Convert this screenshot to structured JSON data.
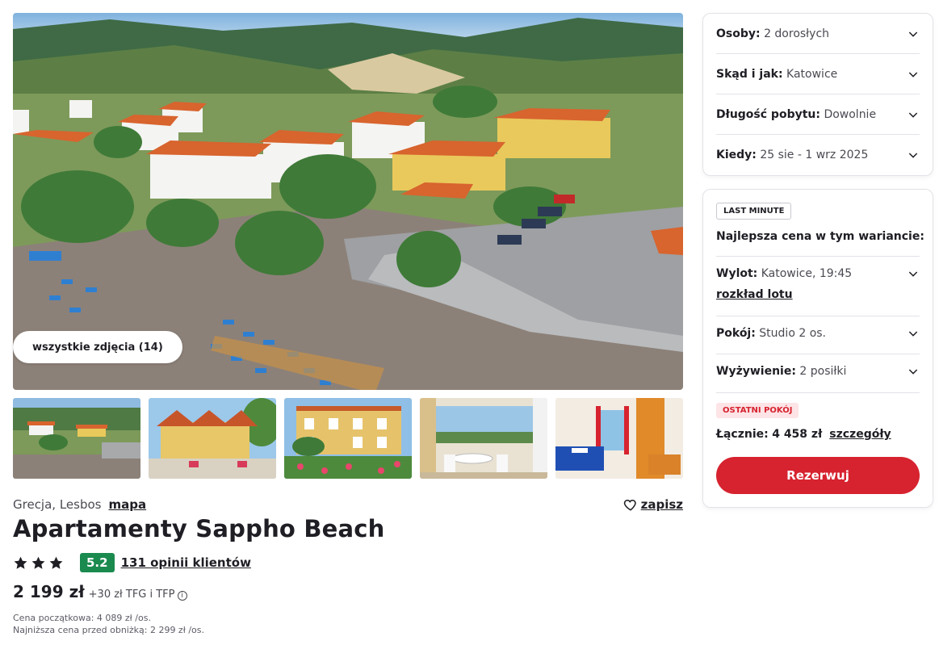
{
  "gallery": {
    "all_photos_label": "wszystkie zdjęcia (14)"
  },
  "hotel": {
    "location": "Grecja, Lesbos",
    "map_label": "mapa",
    "save_label": "zapisz",
    "name": "Apartamenty Sappho Beach",
    "stars": 3,
    "score": "5.2",
    "reviews_label": "131 opinii klientów",
    "price": "2 199 zł",
    "price_extra": "+30 zł TFG i TFP",
    "original_price_note": "Cena początkowa: 4 089 zł /os.",
    "lowest_price_note": "Najniższa cena przed obniżką: 2 299 zł /os."
  },
  "filters": [
    {
      "label": "Osoby:",
      "value": "2 dorosłych"
    },
    {
      "label": "Skąd i jak:",
      "value": "Katowice"
    },
    {
      "label": "Długość pobytu:",
      "value": "Dowolnie"
    },
    {
      "label": "Kiedy:",
      "value": "25 sie - 1 wrz 2025"
    }
  ],
  "offer": {
    "badge": "LAST MINUTE",
    "heading": "Najlepsza cena w tym wariancie:",
    "flight_label": "Wylot:",
    "flight_value": "Katowice, 19:45",
    "flight_link": "rozkład lotu",
    "room_label": "Pokój:",
    "room_value": "Studio 2 os.",
    "board_label": "Wyżywienie:",
    "board_value": "2 posiłki",
    "last_room_badge": "OSTATNI POKÓJ",
    "total_label": "Łącznie:",
    "total_value": "4 458 zł",
    "details_link": "szczegóły",
    "book_label": "Rezerwuj"
  },
  "colors": {
    "accent_red": "#d6232f",
    "score_green": "#1a8a4e",
    "text_dark": "#1e1e24"
  }
}
